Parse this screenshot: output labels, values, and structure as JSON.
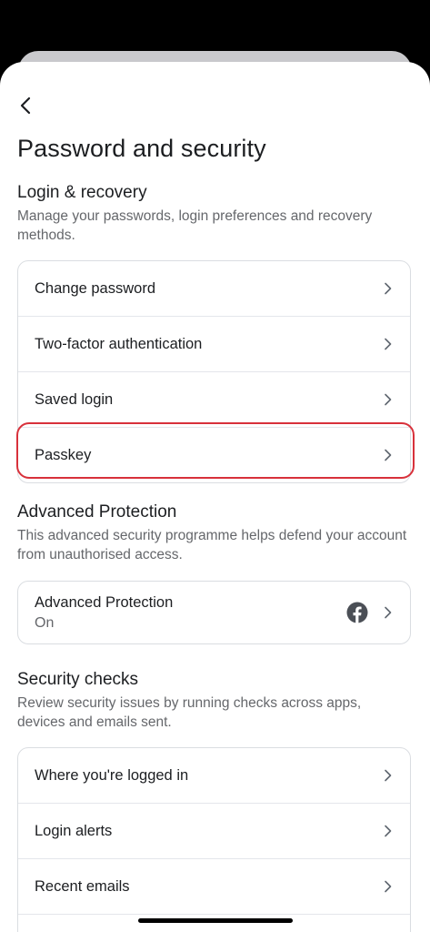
{
  "header": {
    "title": "Password and security"
  },
  "login_recovery": {
    "title": "Login & recovery",
    "description": "Manage your passwords, login preferences and recovery methods.",
    "items": [
      {
        "label": "Change password"
      },
      {
        "label": "Two-factor authentication"
      },
      {
        "label": "Saved login"
      },
      {
        "label": "Passkey"
      }
    ]
  },
  "advanced_protection": {
    "title": "Advanced Protection",
    "description": "This advanced security programme helps defend your account from unauthorised access.",
    "item": {
      "label": "Advanced Protection",
      "status": "On",
      "icon": "facebook-icon"
    }
  },
  "security_checks": {
    "title": "Security checks",
    "description": "Review security issues by running checks across apps, devices and emails sent.",
    "items": [
      {
        "label": "Where you're logged in"
      },
      {
        "label": "Login alerts"
      },
      {
        "label": "Recent emails"
      }
    ]
  },
  "colors": {
    "highlight": "#d8313b",
    "text_primary": "#1c1e21",
    "text_secondary": "#65676b",
    "border": "#dadde1"
  }
}
